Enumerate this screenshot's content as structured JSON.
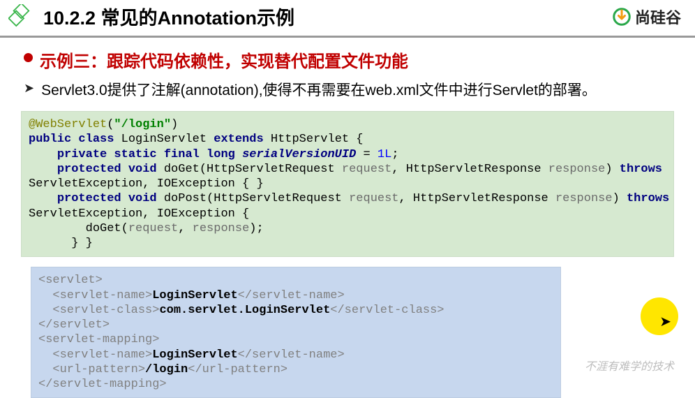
{
  "header": {
    "title": "10.2.2 常见的Annotation示例",
    "brand": "尚硅谷"
  },
  "main": {
    "red_title": "示例三：跟踪代码依赖性，实现替代配置文件功能",
    "sub_text": "Servlet3.0提供了注解(annotation),使得不再需要在web.xml文件中进行Servlet的部署。"
  },
  "code1": {
    "l1a": "@WebServlet",
    "l1b": "(",
    "l1c": "\"/login\"",
    "l1d": ")",
    "l2a": "public class ",
    "l2b": "LoginServlet ",
    "l2c": "extends ",
    "l2d": "HttpServlet {",
    "l3a": "    ",
    "l3b": "private static final long ",
    "l3c": "serialVersionUID",
    "l3d": " = ",
    "l3e": "1L",
    "l3f": ";",
    "l4a": "    ",
    "l4b": "protected void ",
    "l4c": "doGet(HttpServletRequest ",
    "l4d": "request",
    "l4e": ", HttpServletResponse ",
    "l4f": "response",
    "l4g": ") ",
    "l4h": "throws ",
    "l5a": "ServletException, IOException { }",
    "l6a": "    ",
    "l6b": "protected void ",
    "l6c": "doPost(HttpServletRequest ",
    "l6d": "request",
    "l6e": ", HttpServletResponse ",
    "l6f": "response",
    "l6g": ") ",
    "l6h": "throws ",
    "l7a": "ServletException, IOException {",
    "l8a": "        doGet(",
    "l8b": "request",
    "l8c": ", ",
    "l8d": "response",
    "l8e": ");",
    "l9a": "      } }"
  },
  "code2": {
    "l1a": "<servlet>",
    "l2a": "  <servlet-name>",
    "l2b": "LoginServlet",
    "l2c": "</servlet-name>",
    "l3a": "  <servlet-class>",
    "l3b": "com.servlet.LoginServlet",
    "l3c": "</servlet-class>",
    "l4a": "</servlet>",
    "l5a": "<servlet-mapping>",
    "l6a": "  <servlet-name>",
    "l6b": "LoginServlet",
    "l6c": "</servlet-name>",
    "l7a": "  <url-pattern>",
    "l7b": "/login",
    "l7c": "</url-pattern>",
    "l8a": "</servlet-mapping>"
  },
  "footer": {
    "watermark": "不涯有难学的技术"
  }
}
